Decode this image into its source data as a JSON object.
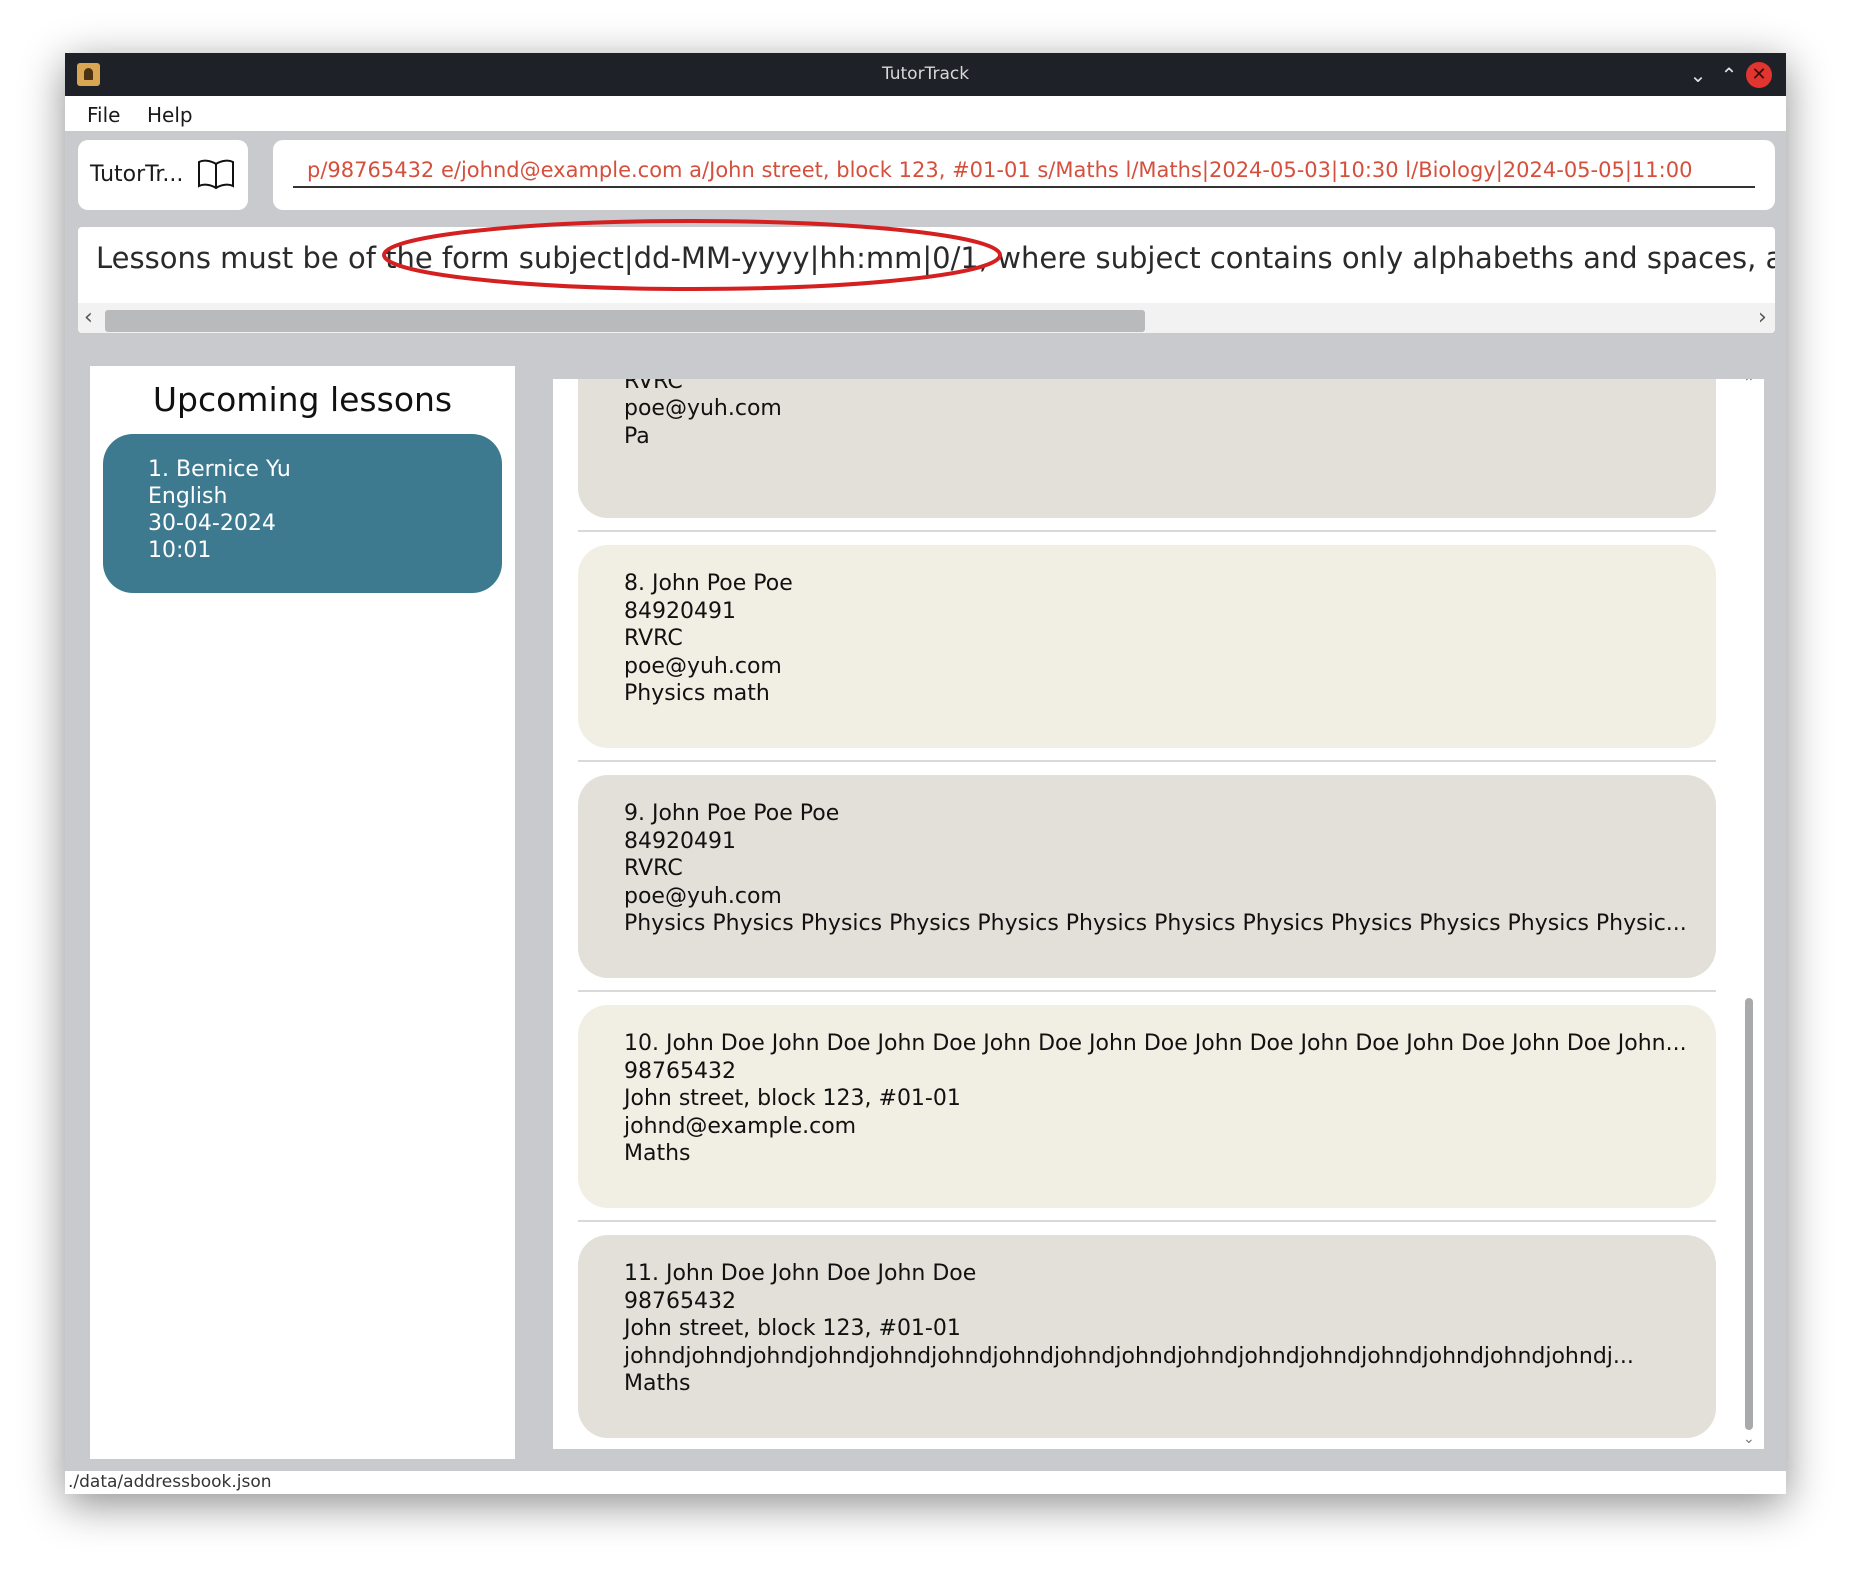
{
  "window": {
    "title": "TutorTrack"
  },
  "menu": {
    "file": "File",
    "help": "Help"
  },
  "toolbar": {
    "logo_text": "TutorTr...",
    "command_value": "p/98765432 e/johnd@example.com a/John street, block 123, #01-01 s/Maths l/Maths|2024-05-03|10:30 l/Biology|2024-05-05|11:00"
  },
  "result": {
    "message": "Lessons must be of the form subject|dd-MM-yyyy|hh:mm|0/1, where subject contains only alphabeths and spaces, a"
  },
  "lessons": {
    "title": "Upcoming lessons",
    "items": [
      {
        "index_name": "1.  Bernice Yu",
        "subject": "English",
        "date": "30-04-2024",
        "time": "10:01"
      }
    ]
  },
  "persons": [
    {
      "name": "",
      "phone": "84920491",
      "address": "RVRC",
      "email": "poe@yuh.com",
      "subjects": "Pa"
    },
    {
      "name": "8.  John Poe Poe",
      "phone": "84920491",
      "address": "RVRC",
      "email": "poe@yuh.com",
      "subjects": "Physics math"
    },
    {
      "name": "9.  John Poe Poe Poe",
      "phone": "84920491",
      "address": "RVRC",
      "email": "poe@yuh.com",
      "subjects": "Physics Physics Physics Physics Physics Physics Physics Physics Physics Physics Physics Physic..."
    },
    {
      "name": "10.  John Doe John Doe John Doe John Doe John Doe John Doe John Doe John Doe John Doe John...",
      "phone": "98765432",
      "address": "John street, block 123, #01-01",
      "email": "johnd@example.com",
      "subjects": "Maths"
    },
    {
      "name": "11.  John Doe John Doe John Doe",
      "phone": "98765432",
      "address": "John street, block 123, #01-01",
      "email": "johndjohndjohndjohndjohndjohndjohndjohndjohndjohndjohndjohndjohndjohndjohndjohndj...",
      "subjects": "Maths"
    }
  ],
  "status": {
    "path": "./data/addressbook.json"
  },
  "colors": {
    "titlebar": "#1e2228",
    "lesson_card": "#3d7a8f",
    "command_text": "#d4503c",
    "highlight_oval": "#d42020",
    "card_even": "#e3e0d9",
    "card_odd": "#f1eee3"
  }
}
